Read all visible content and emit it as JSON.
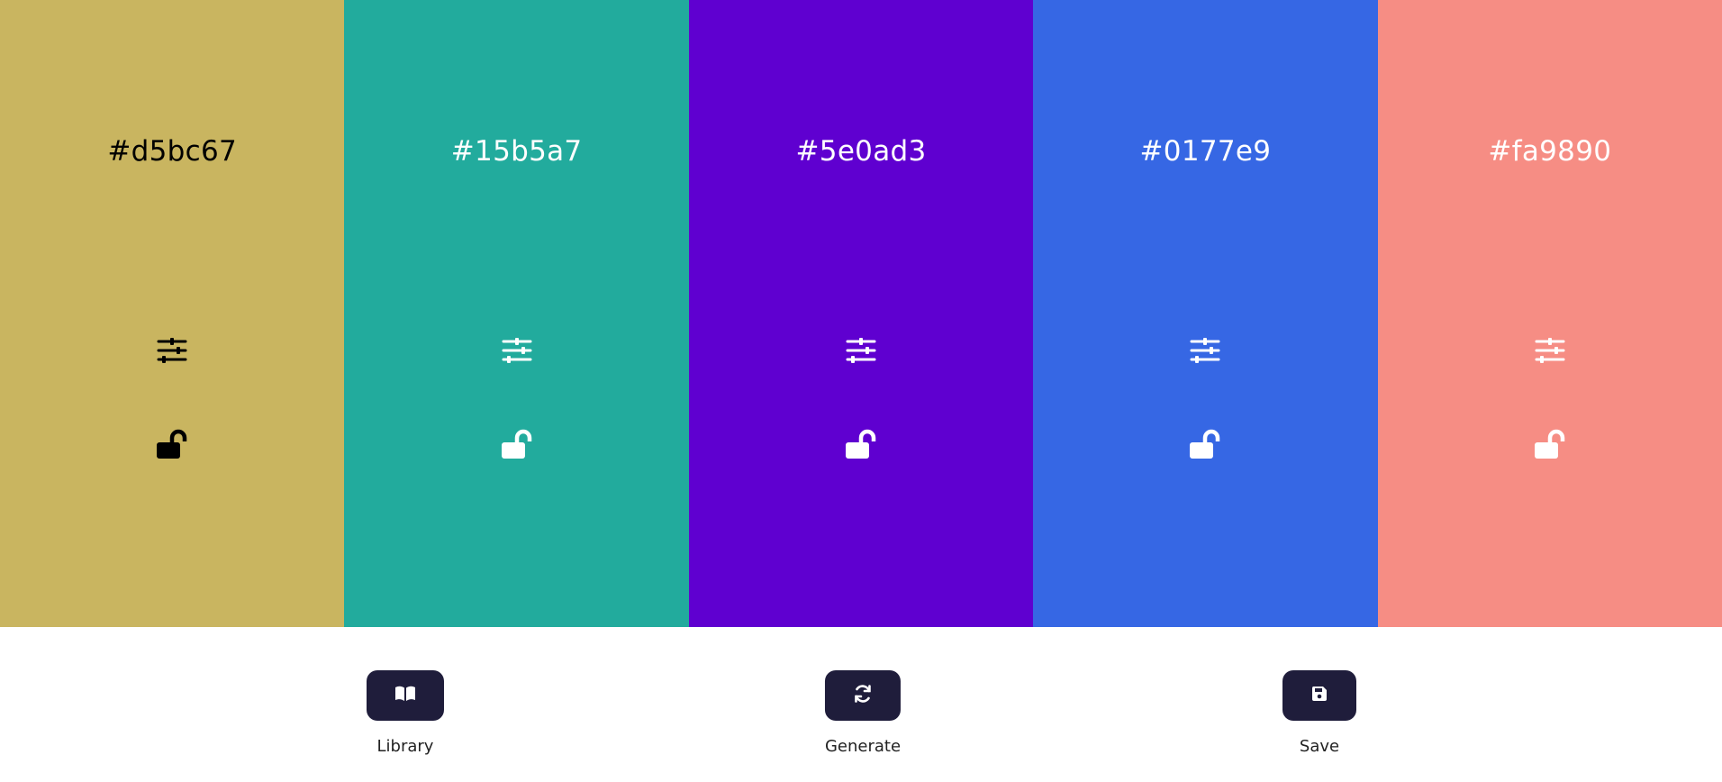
{
  "palette": {
    "colors": [
      {
        "hex": "#d5bc67",
        "swatch": "#c9b560",
        "text_color": "#000000"
      },
      {
        "hex": "#15b5a7",
        "swatch": "#22ab9d",
        "text_color": "#ffffff"
      },
      {
        "hex": "#5e0ad3",
        "swatch": "#5f00d0",
        "text_color": "#ffffff"
      },
      {
        "hex": "#0177e9",
        "swatch": "#3667e4",
        "text_color": "#ffffff"
      },
      {
        "hex": "#fa9890",
        "swatch": "#f68d84",
        "text_color": "#ffffff"
      }
    ],
    "adjust_icon": "sliders-icon",
    "lock_icon": "unlock-icon"
  },
  "toolbar": {
    "button_color": "#1f1d3b",
    "library_label": "Library",
    "library_icon": "book-open-icon",
    "generate_label": "Generate",
    "generate_icon": "refresh-icon",
    "save_label": "Save",
    "save_icon": "floppy-disk-icon"
  }
}
